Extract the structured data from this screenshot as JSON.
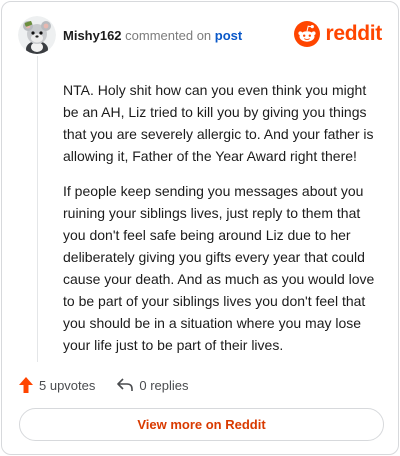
{
  "comment": {
    "username": "Mishy162",
    "action_text": "commented on",
    "link_text": "post",
    "paragraphs": [
      "NTA. Holy shit how can you even think you might be an AH, Liz tried to kill you by giving you things that you are severely allergic to. And your father is allowing it, Father of the Year Award right there!",
      "If people keep sending you messages about you ruining your siblings lives, just reply to them that you don't feel safe being around Liz due to her deliberately giving you gifts every year that could cause your death. And as much as you would love to be part of your siblings lives you don't feel that you should be in a situation where you may lose your life just to be part of their lives."
    ]
  },
  "brand": {
    "name": "reddit",
    "icon": "reddit-logo-icon",
    "color": "#ff4500"
  },
  "actions": {
    "upvotes_label": "5 upvotes",
    "replies_label": "0 replies",
    "upvote_icon": "upvote-arrow-icon",
    "reply_icon": "reply-arrow-icon",
    "upvote_color": "#ff4500"
  },
  "footer": {
    "view_more_label": "View more on Reddit",
    "color": "#d93a00"
  }
}
